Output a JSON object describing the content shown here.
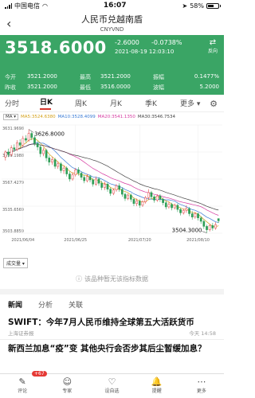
{
  "status_bar": {
    "carrier": "中国电信",
    "time": "16:07",
    "battery": "58%",
    "battery_level": 0.58
  },
  "nav": {
    "title": "人民币兑越南盾",
    "subtitle": "CNYVND"
  },
  "quote": {
    "price": "3518.6000",
    "change": "-2.6000",
    "change_pct": "-0.0738%",
    "datetime": "2021-08-19 12:03:10",
    "switch_label": "反向",
    "color": "#3aa565"
  },
  "stats": [
    [
      {
        "label": "今开",
        "value": "3521.2000"
      },
      {
        "label": "最高",
        "value": "3521.2000"
      },
      {
        "label": "振幅",
        "value": "0.1477%"
      }
    ],
    [
      {
        "label": "昨收",
        "value": "3521.2000"
      },
      {
        "label": "最低",
        "value": "3516.0000"
      },
      {
        "label": "波幅",
        "value": "5.2000"
      }
    ]
  ],
  "period_tabs": [
    "分时",
    "日K",
    "周K",
    "月K",
    "季K",
    "更多"
  ],
  "active_tab": "日K",
  "ma": {
    "tag": "MA",
    "items": [
      {
        "label": "MA5:3524.6380",
        "color": "#d4a017"
      },
      {
        "label": "MA10:3528.4099",
        "color": "#3a7bd5"
      },
      {
        "label": "MA20:3541.1350",
        "color": "#d63aa0"
      },
      {
        "label": "MA30:3546.7534",
        "color": "#444444"
      }
    ]
  },
  "chart_data": {
    "type": "candlestick",
    "y_ticks": [
      "3631.9698",
      "3599.1988",
      "3567.4279",
      "3535.6569",
      "3503.8859"
    ],
    "ylim": [
      3503.8859,
      3631.9698
    ],
    "x_ticks": [
      "2021/06/04",
      "2021/06/25",
      "2021/07/20",
      "2021/08/10"
    ],
    "annotations": [
      {
        "label": "3626.8000",
        "value": 3626.8,
        "type": "max"
      },
      {
        "label": "3504.3000",
        "value": 3504.3,
        "type": "min"
      }
    ],
    "candles": [
      [
        3594,
        3600,
        3590,
        3602
      ],
      [
        3600,
        3597,
        3594,
        3604
      ],
      [
        3597,
        3605,
        3595,
        3608
      ],
      [
        3605,
        3603,
        3600,
        3609
      ],
      [
        3603,
        3611,
        3601,
        3614
      ],
      [
        3611,
        3608,
        3605,
        3615
      ],
      [
        3608,
        3616,
        3606,
        3619
      ],
      [
        3616,
        3614,
        3611,
        3620
      ],
      [
        3614,
        3622,
        3612,
        3626.8
      ],
      [
        3622,
        3617,
        3614,
        3624
      ],
      [
        3617,
        3610,
        3607,
        3620
      ],
      [
        3610,
        3606,
        3602,
        3613
      ],
      [
        3606,
        3598,
        3594,
        3609
      ],
      [
        3598,
        3602,
        3595,
        3605
      ],
      [
        3602,
        3593,
        3589,
        3604
      ],
      [
        3593,
        3588,
        3584,
        3596
      ],
      [
        3588,
        3591,
        3585,
        3594
      ],
      [
        3591,
        3583,
        3580,
        3593
      ],
      [
        3583,
        3586,
        3580,
        3589
      ],
      [
        3586,
        3578,
        3575,
        3588
      ],
      [
        3578,
        3581,
        3574,
        3584
      ],
      [
        3581,
        3574,
        3571,
        3583
      ],
      [
        3574,
        3568,
        3565,
        3577
      ],
      [
        3568,
        3573,
        3566,
        3576
      ],
      [
        3573,
        3579,
        3571,
        3581
      ],
      [
        3579,
        3575,
        3572,
        3582
      ],
      [
        3575,
        3570,
        3567,
        3577
      ],
      [
        3570,
        3566,
        3563,
        3573
      ],
      [
        3566,
        3571,
        3564,
        3574
      ],
      [
        3571,
        3567,
        3564,
        3573
      ],
      [
        3567,
        3562,
        3559,
        3569
      ],
      [
        3562,
        3568,
        3560,
        3571
      ],
      [
        3568,
        3563,
        3560,
        3570
      ],
      [
        3563,
        3558,
        3555,
        3566
      ],
      [
        3558,
        3562,
        3555,
        3565
      ],
      [
        3562,
        3556,
        3553,
        3564
      ],
      [
        3556,
        3551,
        3548,
        3558
      ],
      [
        3551,
        3555,
        3549,
        3557
      ],
      [
        3555,
        3560,
        3553,
        3562
      ],
      [
        3560,
        3556,
        3553,
        3563
      ],
      [
        3556,
        3550,
        3547,
        3558
      ],
      [
        3550,
        3545,
        3542,
        3552
      ],
      [
        3545,
        3549,
        3543,
        3551
      ],
      [
        3549,
        3544,
        3541,
        3551
      ],
      [
        3544,
        3539,
        3536,
        3546
      ],
      [
        3539,
        3542,
        3536,
        3545
      ],
      [
        3542,
        3537,
        3534,
        3544
      ],
      [
        3537,
        3541,
        3535,
        3543
      ],
      [
        3541,
        3546,
        3539,
        3548
      ],
      [
        3546,
        3552,
        3544,
        3556
      ],
      [
        3552,
        3547,
        3544,
        3554
      ],
      [
        3547,
        3543,
        3540,
        3549
      ],
      [
        3543,
        3548,
        3541,
        3550
      ],
      [
        3548,
        3544,
        3541,
        3550
      ],
      [
        3544,
        3540,
        3537,
        3546
      ],
      [
        3540,
        3535,
        3532,
        3542
      ],
      [
        3535,
        3538,
        3533,
        3541
      ],
      [
        3538,
        3534,
        3531,
        3540
      ],
      [
        3534,
        3537,
        3532,
        3539
      ],
      [
        3537,
        3532,
        3529,
        3539
      ],
      [
        3532,
        3528,
        3525,
        3534
      ],
      [
        3528,
        3531,
        3526,
        3533
      ],
      [
        3531,
        3533,
        3528,
        3537
      ],
      [
        3533,
        3527,
        3524,
        3535
      ],
      [
        3527,
        3523,
        3520,
        3530
      ],
      [
        3523,
        3527,
        3521,
        3529
      ],
      [
        3527,
        3522,
        3519,
        3528
      ],
      [
        3522,
        3518,
        3515,
        3524
      ],
      [
        3518,
        3512,
        3509,
        3520
      ],
      [
        3512,
        3508,
        3504.3,
        3514
      ],
      [
        3508,
        3513,
        3506,
        3515
      ],
      [
        3513,
        3510,
        3507,
        3516
      ],
      [
        3510,
        3514,
        3508,
        3517
      ],
      [
        3521.2,
        3518.6,
        3516,
        3521.2
      ]
    ]
  },
  "volume_tag": "成交量",
  "no_indicator_text": "该品种暂无该指标数据",
  "news_tabs": [
    "新闻",
    "分析",
    "关联"
  ],
  "news": [
    {
      "title": "SWIFT：今年7月人民币维持全球第五大活跃货币",
      "source": "上海证券报",
      "time": "今天 14:58"
    },
    {
      "title": "新西兰加息“疫”变 其他央行会否步其后尘暂缓加息？",
      "source": "",
      "time": ""
    }
  ],
  "bottom_bar": [
    {
      "label": "评论",
      "icon": "comment-icon",
      "glyph": "✎",
      "badge": "+67"
    },
    {
      "label": "专家",
      "icon": "expert-icon",
      "glyph": "☺"
    },
    {
      "label": "设自选",
      "icon": "favorite-icon",
      "glyph": "♡"
    },
    {
      "label": "提醒",
      "icon": "bell-icon",
      "glyph": "🔔"
    },
    {
      "label": "更多",
      "icon": "more-icon",
      "glyph": "⋯"
    }
  ]
}
